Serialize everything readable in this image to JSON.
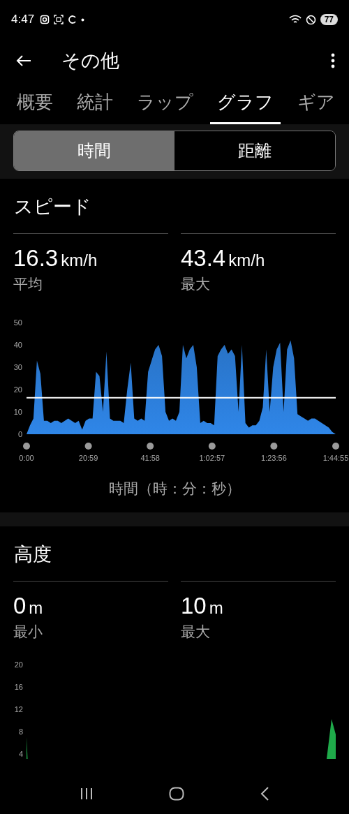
{
  "status_bar": {
    "time": "4:47",
    "battery": "77"
  },
  "app_bar": {
    "title": "その他"
  },
  "tabs": [
    {
      "label": "概要",
      "selected": false
    },
    {
      "label": "統計",
      "selected": false
    },
    {
      "label": "ラップ",
      "selected": false
    },
    {
      "label": "グラフ",
      "selected": true
    },
    {
      "label": "ギア",
      "selected": false
    }
  ],
  "segments": [
    {
      "label": "時間",
      "selected": true
    },
    {
      "label": "距離",
      "selected": false
    }
  ],
  "sections": [
    {
      "title": "スピード",
      "stats": [
        {
          "value": "16.3",
          "unit": "km/h",
          "label": "平均"
        },
        {
          "value": "43.4",
          "unit": "km/h",
          "label": "最大"
        }
      ],
      "chart_data": {
        "type": "area",
        "xlabel": "時間（時：分：秒）",
        "ylim": [
          0,
          50
        ],
        "yticks": [
          0,
          10,
          20,
          30,
          40,
          50
        ],
        "xlim": [
          0,
          6295
        ],
        "xticks": [
          {
            "value": 0,
            "label": "0:00"
          },
          {
            "value": 1259,
            "label": "20:59"
          },
          {
            "value": 2518,
            "label": "41:58"
          },
          {
            "value": 3777,
            "label": "1:02:57"
          },
          {
            "value": 5036,
            "label": "1:23:56"
          },
          {
            "value": 6295,
            "label": "1:44:55"
          }
        ],
        "x": [
          0,
          71,
          141,
          212,
          283,
          354,
          424,
          495,
          566,
          637,
          707,
          778,
          849,
          919,
          990,
          1061,
          1132,
          1202,
          1273,
          1344,
          1415,
          1485,
          1556,
          1627,
          1698,
          1768,
          1839,
          1910,
          1980,
          2051,
          2122,
          2193,
          2263,
          2334,
          2405,
          2476,
          2546,
          2617,
          2688,
          2758,
          2829,
          2900,
          2971,
          3041,
          3112,
          3183,
          3254,
          3324,
          3395,
          3466,
          3537,
          3607,
          3678,
          3749,
          3819,
          3890,
          3961,
          4032,
          4102,
          4173,
          4244,
          4315,
          4385,
          4456,
          4527,
          4597,
          4668,
          4739,
          4810,
          4880,
          4951,
          5022,
          5093,
          5163,
          5234,
          5305,
          5376,
          5446,
          5517,
          5588,
          5658,
          5729,
          5800,
          5871,
          5941,
          6012,
          6083,
          6154,
          6224,
          6295
        ],
        "series": [
          {
            "color": "#2f86e8",
            "values": [
              0,
              4,
              7,
              33,
              27,
              6,
              6,
              5,
              6,
              6,
              5,
              6,
              7,
              6,
              5,
              6,
              2,
              6,
              7,
              7,
              28,
              26,
              10,
              37,
              7,
              6,
              6,
              6,
              5,
              20,
              32,
              7,
              6,
              7,
              6,
              28,
              33,
              38,
              40,
              35,
              10,
              6,
              7,
              6,
              10,
              40,
              34,
              38,
              40,
              30,
              5,
              6,
              5,
              5,
              4,
              35,
              38,
              40,
              36,
              38,
              35,
              10,
              40,
              5,
              3,
              4,
              4,
              6,
              12,
              38,
              10,
              30,
              38,
              41,
              10,
              38,
              42,
              34,
              9,
              8,
              7,
              6,
              7,
              7,
              6,
              5,
              4,
              3,
              1,
              0
            ]
          }
        ],
        "ref_lines": [
          {
            "axis": "y",
            "value": 16.3
          }
        ]
      }
    },
    {
      "title": "高度",
      "stats": [
        {
          "value": "0",
          "unit": "m",
          "label": "最小"
        },
        {
          "value": "10",
          "unit": "m",
          "label": "最大"
        }
      ],
      "axis_labels": [
        "20",
        "16",
        "12",
        "8",
        "4"
      ]
    }
  ]
}
